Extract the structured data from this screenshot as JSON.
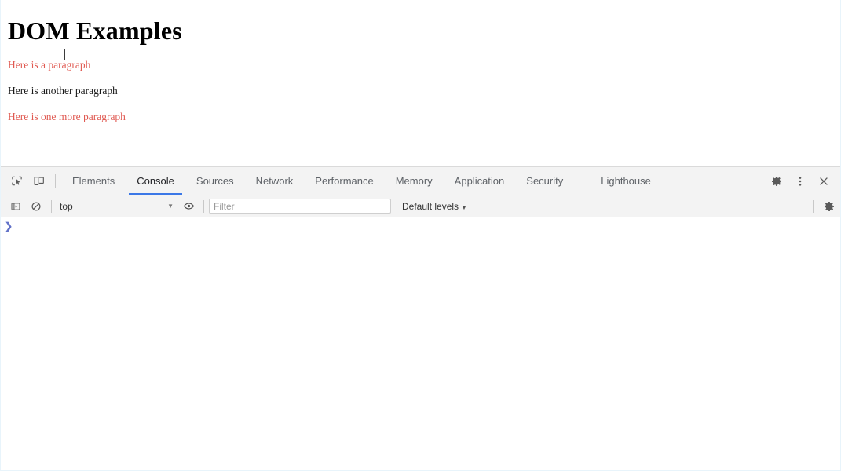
{
  "page": {
    "heading": "DOM Examples",
    "paragraphs": [
      {
        "text": "Here is a paragraph",
        "color": "#e05a52"
      },
      {
        "text": "Here is another paragraph",
        "color": "#1a1a1a"
      },
      {
        "text": "Here is one more paragraph",
        "color": "#e05a52"
      }
    ]
  },
  "devtools": {
    "left_tools": [
      {
        "name": "inspect-element-icon",
        "title": "Inspect element"
      },
      {
        "name": "device-toolbar-icon",
        "title": "Toggle device toolbar"
      }
    ],
    "tabs": [
      {
        "label": "Elements",
        "active": false
      },
      {
        "label": "Console",
        "active": true
      },
      {
        "label": "Sources",
        "active": false
      },
      {
        "label": "Network",
        "active": false
      },
      {
        "label": "Performance",
        "active": false
      },
      {
        "label": "Memory",
        "active": false
      },
      {
        "label": "Application",
        "active": false
      },
      {
        "label": "Security",
        "active": false
      },
      {
        "label": "Lighthouse",
        "active": false
      }
    ],
    "right_actions": [
      {
        "name": "settings-gear-icon",
        "title": "Settings"
      },
      {
        "name": "more-options-icon",
        "title": "Customize and control DevTools"
      },
      {
        "name": "close-devtools-icon",
        "title": "Close DevTools"
      }
    ],
    "accent_color": "#3b78e7",
    "toolbar_background": "#f3f3f3"
  },
  "console": {
    "sidebar_toggle": "console-sidebar-icon",
    "clear_button": "clear-console-icon",
    "context": {
      "value": "top",
      "arrow": "▼"
    },
    "eye_button": "live-expression-eye-icon",
    "filter": {
      "value": "",
      "placeholder": "Filter"
    },
    "levels": {
      "label": "Default levels",
      "arrow": "▼"
    },
    "settings_button": "console-settings-icon",
    "prompt_symbol": "❯",
    "prompt_value": ""
  }
}
